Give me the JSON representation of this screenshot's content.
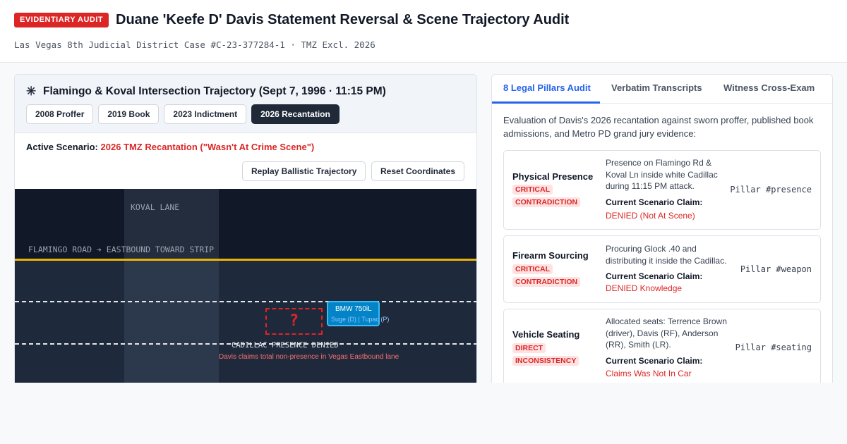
{
  "header": {
    "badge": "EVIDENTIARY AUDIT",
    "title": "Duane 'Keefe D' Davis Statement Reversal & Scene Trajectory Audit",
    "subtitle": "Las Vegas 8th Judicial District Case #C-23-377284-1 · TMZ Excl. 2026"
  },
  "left_panel": {
    "icon": "crosshair-icon",
    "title": "Flamingo & Koval Intersection Trajectory (Sept 7, 1996 · 11:15 PM)",
    "scenario_tabs": [
      {
        "label": "2008 Proffer",
        "active": false
      },
      {
        "label": "2019 Book",
        "active": false
      },
      {
        "label": "2023 Indictment",
        "active": false
      },
      {
        "label": "2026 Recantation",
        "active": true
      }
    ],
    "active_label": "Active Scenario:",
    "active_value": "2026 TMZ Recantation (\"Wasn't At Crime Scene\")",
    "replay_label": "Replay Ballistic Trajectory",
    "reset_label": "Reset Coordinates",
    "map": {
      "street_koval": "KOVAL LANE",
      "street_flamingo": "FLAMINGO ROAD ➔ EASTBOUND TOWARD STRIP",
      "unknown_marker": "?",
      "vehicle_label": "BMW 750iL",
      "vehicle_occupants": "Suge (D) | Tupac (P)",
      "denied_label": "CADILLAC PRESENCE DENIED",
      "claim_label": "Davis claims total non-presence in Vegas Eastbound lane"
    }
  },
  "right_panel": {
    "tabs": [
      {
        "label": "8 Legal Pillars Audit",
        "active": true
      },
      {
        "label": "Verbatim Transcripts",
        "active": false
      },
      {
        "label": "Witness Cross-Exam",
        "active": false
      }
    ],
    "intro": "Evaluation of Davis's 2026 recantation against sworn proffer, published book admissions, and Metro PD grand jury evidence:",
    "claim_heading": "Current Scenario Claim:",
    "pillars": [
      {
        "name": "Physical Presence",
        "badge": "CRITICAL CONTRADICTION",
        "description": "Presence on Flamingo Rd & Koval Ln inside white Cadillac during 11:15 PM attack.",
        "claim": "DENIED (Not At Scene)",
        "tag": "Pillar #presence"
      },
      {
        "name": "Firearm Sourcing",
        "badge": "CRITICAL CONTRADICTION",
        "description": "Procuring Glock .40 and distributing it inside the Cadillac.",
        "claim": "DENIED Knowledge",
        "tag": "Pillar #weapon"
      },
      {
        "name": "Vehicle Seating",
        "badge": "DIRECT INCONSISTENCY",
        "description": "Allocated seats: Terrence Brown (driver), Davis (RF), Anderson (RR), Smith (LR).",
        "claim": "Claims Was Not In Car",
        "tag": "Pillar #seating"
      }
    ]
  },
  "colors": {
    "accent_red": "#dc2626",
    "accent_blue": "#2563eb",
    "dark": "#1f2937",
    "map_bg": "#111827",
    "road_line": "#eab308",
    "vehicle_blue": "#0284c7"
  }
}
